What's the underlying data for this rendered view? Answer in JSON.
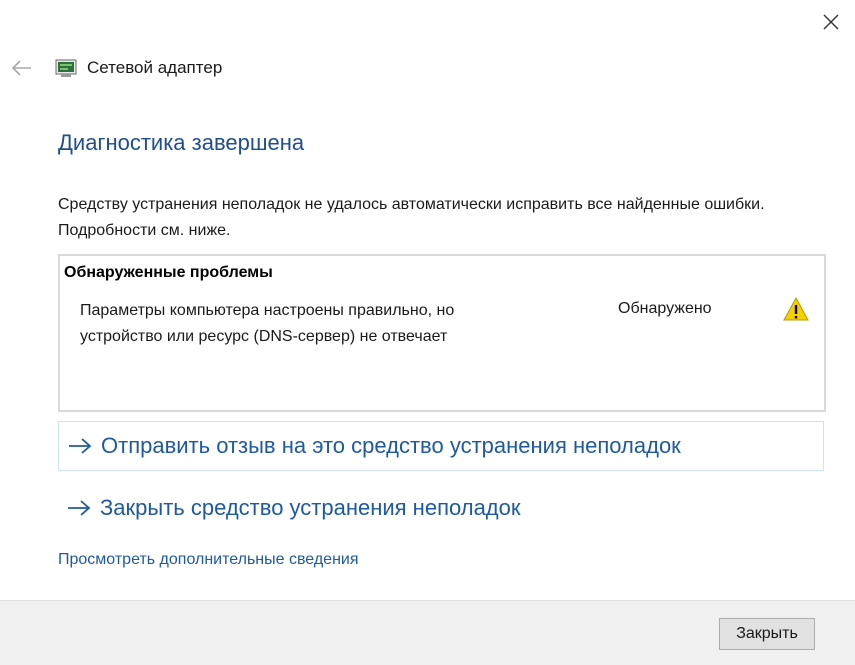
{
  "header": {
    "title": "Сетевой адаптер"
  },
  "main": {
    "page_title": "Диагностика завершена",
    "description": "Средству устранения неполадок не удалось автоматически исправить все найденные ошибки. Подробности см. ниже.",
    "problems": {
      "heading": "Обнаруженные проблемы",
      "items": [
        {
          "text": "Параметры компьютера настроены правильно, но устройство или ресурс (DNS-сервер) не отвечает",
          "status": "Обнаружено",
          "icon": "warning-icon"
        }
      ]
    },
    "actions": [
      {
        "label": "Отправить отзыв на это средство устранения неполадок",
        "icon": "arrow-right-icon"
      },
      {
        "label": "Закрыть средство устранения неполадок",
        "icon": "arrow-right-icon"
      }
    ],
    "details_link": "Просмотреть дополнительные сведения"
  },
  "footer": {
    "close_label": "Закрыть"
  },
  "colors": {
    "title": "#1f4e8c",
    "link": "#1f5aa0",
    "warning": "#f5d000",
    "footer_bg": "#f0f0f0"
  }
}
